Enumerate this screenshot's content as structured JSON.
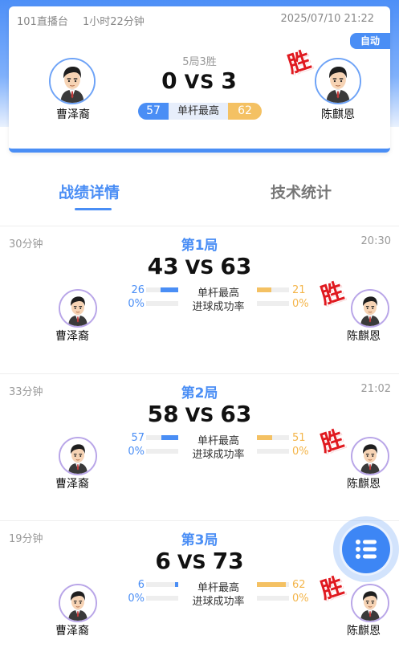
{
  "header": {
    "channel": "101直播台",
    "duration": "1小时22分钟",
    "datetime": "2025/07/10 21:22",
    "auto_label": "自动",
    "format": "5局3胜",
    "score_left": "0",
    "score_right": "3",
    "vs": "VS",
    "high_break_label": "单杆最高",
    "high_break_left": "57",
    "high_break_right": "62",
    "win_mark": "胜"
  },
  "players": {
    "left": "曹泽裔",
    "right": "陈麒恩"
  },
  "tabs": {
    "active": "战绩详情",
    "inactive": "技术统计"
  },
  "colors": {
    "primary": "#4a8ef5",
    "accent": "#f4c163",
    "win": "#e0191f"
  },
  "frames": [
    {
      "duration": "30分钟",
      "end_time": "20:30",
      "title": "第1局",
      "score_left": "43",
      "score_right": "63",
      "vs": "VS",
      "stat1_label": "单杆最高",
      "stat1_left": "26",
      "stat1_right": "21",
      "stat1_left_fill": 0.55,
      "stat1_right_fill": 0.45,
      "stat2_label": "进球成功率",
      "stat2_left": "0%",
      "stat2_right": "0%",
      "stat2_left_fill": 0,
      "stat2_right_fill": 0,
      "winner_mark": "胜",
      "player_left": "曹泽裔",
      "player_right": "陈麒恩"
    },
    {
      "duration": "33分钟",
      "end_time": "21:02",
      "title": "第2局",
      "score_left": "58",
      "score_right": "63",
      "vs": "VS",
      "stat1_label": "单杆最高",
      "stat1_left": "57",
      "stat1_right": "51",
      "stat1_left_fill": 0.53,
      "stat1_right_fill": 0.47,
      "stat2_label": "进球成功率",
      "stat2_left": "0%",
      "stat2_right": "0%",
      "stat2_left_fill": 0,
      "stat2_right_fill": 0,
      "winner_mark": "胜",
      "player_left": "曹泽裔",
      "player_right": "陈麒恩"
    },
    {
      "duration": "19分钟",
      "end_time": "",
      "title": "第3局",
      "score_left": "6",
      "score_right": "73",
      "vs": "VS",
      "stat1_label": "单杆最高",
      "stat1_left": "6",
      "stat1_right": "62",
      "stat1_left_fill": 0.09,
      "stat1_right_fill": 0.91,
      "stat2_label": "进球成功率",
      "stat2_left": "0%",
      "stat2_right": "0%",
      "stat2_left_fill": 0,
      "stat2_right_fill": 0,
      "winner_mark": "胜",
      "player_left": "曹泽裔",
      "player_right": "陈麒恩"
    }
  ],
  "fab": {
    "icon": "list-icon"
  }
}
